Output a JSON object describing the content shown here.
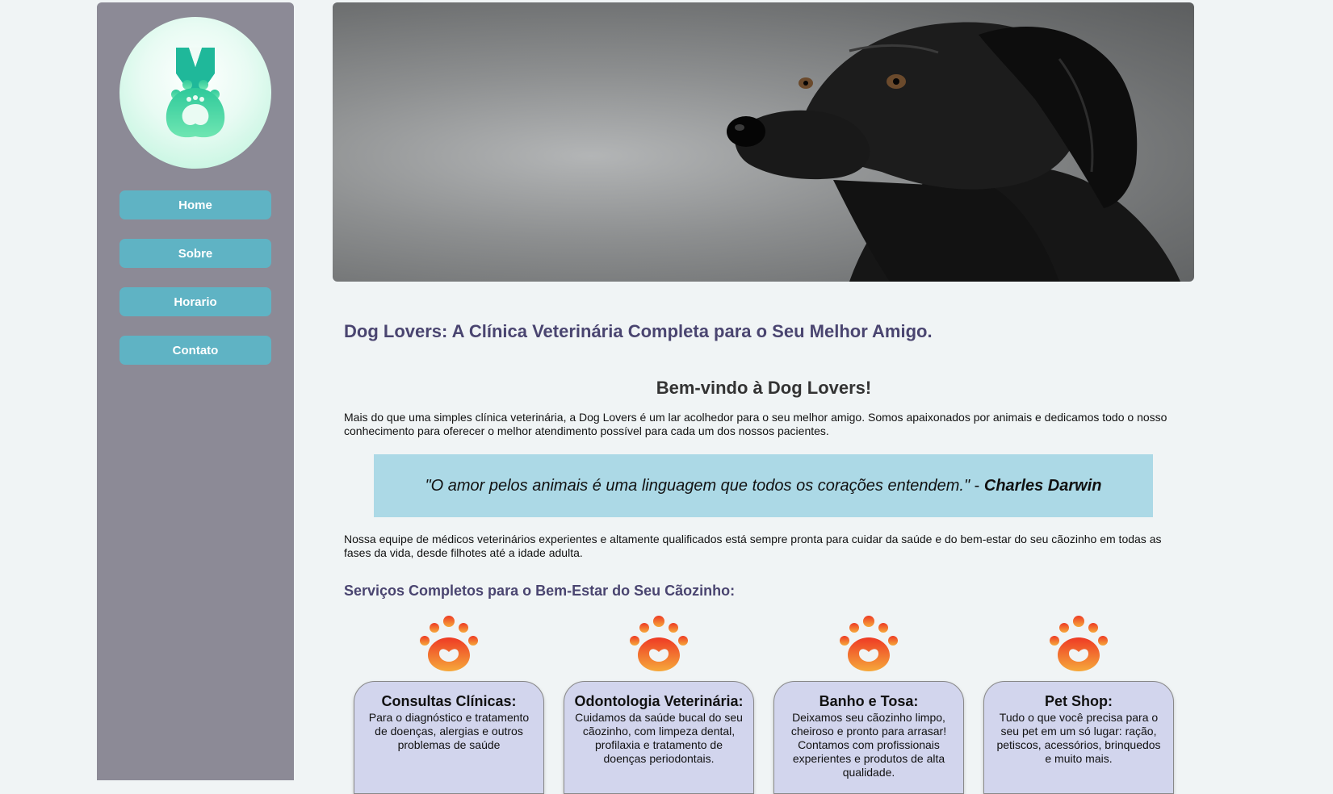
{
  "sidebar": {
    "logo_icon": "medal-paw-icon",
    "nav": [
      {
        "label": "Home"
      },
      {
        "label": "Sobre"
      },
      {
        "label": "Horario"
      },
      {
        "label": "Contato"
      }
    ]
  },
  "hero": {
    "image": "black-dog-photo"
  },
  "main": {
    "title": "Dog Lovers: A Clínica Veterinária Completa para o Seu Melhor Amigo.",
    "welcome": "Bem-vindo à Dog Lovers!",
    "intro": "Mais do que uma simples clínica veterinária, a Dog Lovers é um lar acolhedor para o seu melhor amigo. Somos apaixonados por animais e dedicamos todo o nosso conhecimento para oferecer o melhor atendimento possível para cada um dos nossos pacientes.",
    "quote": {
      "text": "\"O amor pelos animais é uma linguagem que todos os corações entendem.\"",
      "separator": " - ",
      "author": "Charles Darwin"
    },
    "team": "Nossa equipe de médicos veterinários experientes e altamente qualificados está sempre pronta para cuidar da saúde e do bem-estar do seu cãozinho em todas as fases da vida, desde filhotes até a idade adulta.",
    "services_title": "Serviços Completos para o Bem-Estar do Seu Cãozinho:",
    "services": [
      {
        "icon": "paw-icon",
        "title": "Consultas Clínicas:",
        "text": "Para o diagnóstico e tratamento de doenças, alergias e outros problemas de saúde"
      },
      {
        "icon": "paw-icon",
        "title": "Odontologia Veterinária:",
        "text": "Cuidamos da saúde bucal do seu cãozinho, com limpeza dental, profilaxia e tratamento de doenças periodontais."
      },
      {
        "icon": "paw-icon",
        "title": "Banho e Tosa:",
        "text": "Deixamos seu cãozinho limpo, cheiroso e pronto para arrasar! Contamos com profissionais experientes e produtos de alta qualidade."
      },
      {
        "icon": "paw-icon",
        "title": "Pet Shop:",
        "text": "Tudo o que você precisa para o seu pet em um só lugar: ração, petiscos, acessórios, brinquedos e muito mais."
      }
    ]
  },
  "colors": {
    "sidebar": "#8c8a96",
    "nav_button": "#5fb3c4",
    "heading": "#4a4570",
    "quote_bg": "#acd9e6",
    "card_bg": "#d2d5ed"
  }
}
